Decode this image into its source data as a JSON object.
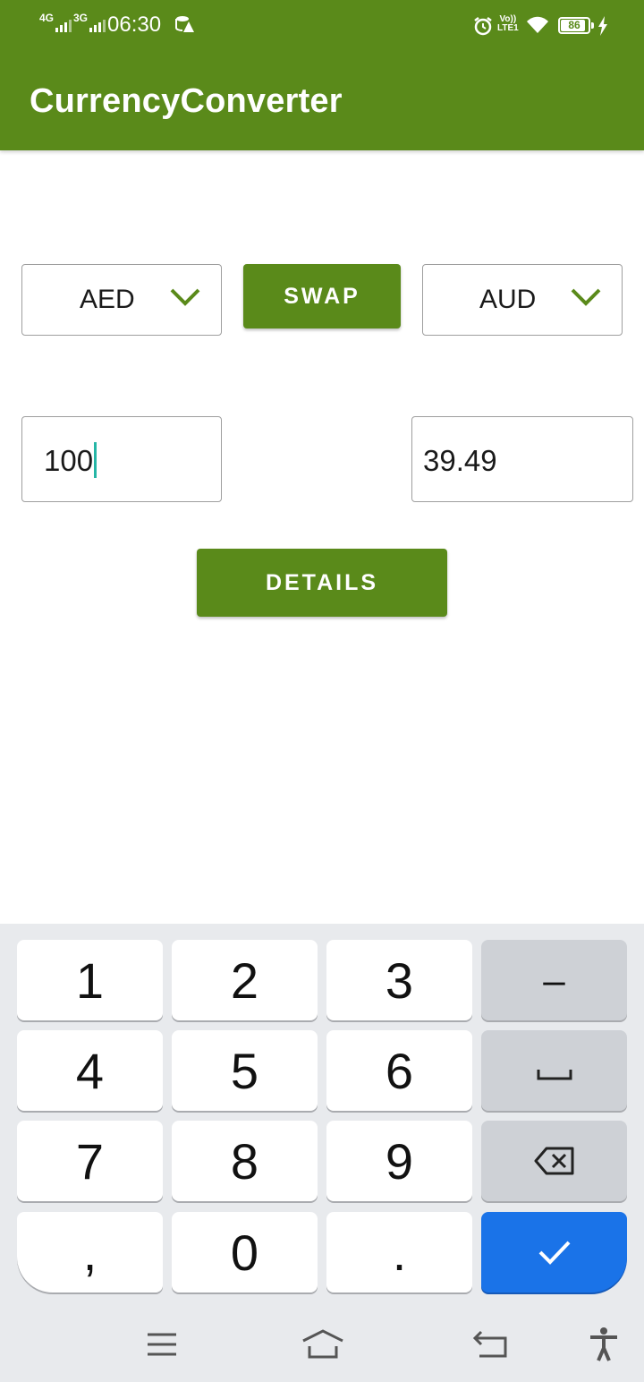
{
  "status_bar": {
    "network_1": "4G",
    "network_2": "3G",
    "time": "06:30",
    "volte": "Vo))\nLTE1",
    "battery": "86"
  },
  "app_bar": {
    "title": "CurrencyConverter"
  },
  "converter": {
    "from_currency": "AED",
    "to_currency": "AUD",
    "swap_label": "SWAP",
    "amount_input": "100",
    "result_value": "39.49",
    "details_label": "DETAILS"
  },
  "keyboard": {
    "rows": [
      [
        "1",
        "2",
        "3",
        "–"
      ],
      [
        "4",
        "5",
        "6",
        "space"
      ],
      [
        "7",
        "8",
        "9",
        "backspace"
      ],
      [
        ",",
        "0",
        ".",
        "done"
      ]
    ],
    "key_1": "1",
    "key_2": "2",
    "key_3": "3",
    "key_minus": "–",
    "key_4": "4",
    "key_5": "5",
    "key_6": "6",
    "key_7": "7",
    "key_8": "8",
    "key_9": "9",
    "key_comma": ",",
    "key_0": "0",
    "key_dot": "."
  },
  "icons": {
    "dropdown": "chevron-down-icon",
    "space": "space-icon",
    "backspace": "backspace-icon",
    "done": "check-icon",
    "nav_menu": "menu-icon",
    "nav_home": "home-icon",
    "nav_back": "back-icon",
    "nav_accessibility": "accessibility-icon"
  },
  "colors": {
    "app_bar": "#5a8a1a",
    "accent": "#5a8a1a",
    "cursor": "#26b6a6",
    "keyboard_bg": "#e8eaed",
    "done_key": "#1a73e8"
  }
}
